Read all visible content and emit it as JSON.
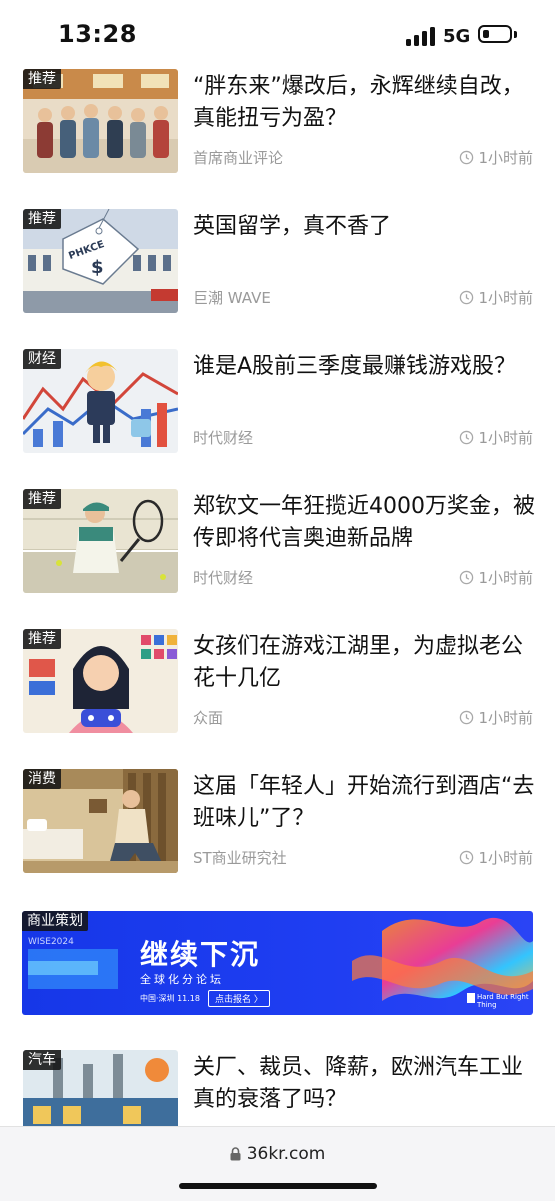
{
  "status": {
    "time": "13:28",
    "network": "5G"
  },
  "articles": [
    {
      "tag": "推荐",
      "title": "“胖东来”爆改后，永辉继续自改，真能扭亏为盈？",
      "source": "首席商业评论",
      "time": "1小时前",
      "thumb": "store-crowd"
    },
    {
      "tag": "推荐",
      "title": "英国留学，真不香了",
      "source": "巨潮 WAVE",
      "time": "1小时前",
      "thumb": "price-tag",
      "thumb_text": "PHKCE"
    },
    {
      "tag": "财经",
      "title": "谁是A股前三季度最赚钱游戏股？",
      "source": "时代财经",
      "time": "1小时前",
      "thumb": "game-chart"
    },
    {
      "tag": "推荐",
      "title": "郑钦文一年狂揽近4000万奖金，被传即将代言奥迪新品牌",
      "source": "时代财经",
      "time": "1小时前",
      "thumb": "tennis-player"
    },
    {
      "tag": "推荐",
      "title": "女孩们在游戏江湖里，为虚拟老公花十几亿",
      "source": "众面",
      "time": "1小时前",
      "thumb": "girl-gaming"
    },
    {
      "tag": "消费",
      "title": "这届「年轻人」开始流行到酒店“去班味儿”了？",
      "source": "ST商业研究社",
      "time": "1小时前",
      "thumb": "hotel-room"
    },
    {
      "tag": "汽车",
      "title": "关厂、裁员、降薪，欧洲汽车工业真的衰落了吗？",
      "source": "",
      "time": "",
      "thumb": "factory"
    }
  ],
  "banner": {
    "tag": "商业策划",
    "wise": "WISE2024",
    "title": "继续下沉",
    "subtitle": "全球化分论坛",
    "date": "中国·深圳 11.18",
    "button": "点击报名 〉",
    "brand": "Hard But Right Thing"
  },
  "browser": {
    "url": "36kr.com"
  },
  "colors": {
    "tag_bg": "#1a1a1a",
    "meta_text": "#9a9a9a",
    "banner_blue": "#1e3df0"
  }
}
